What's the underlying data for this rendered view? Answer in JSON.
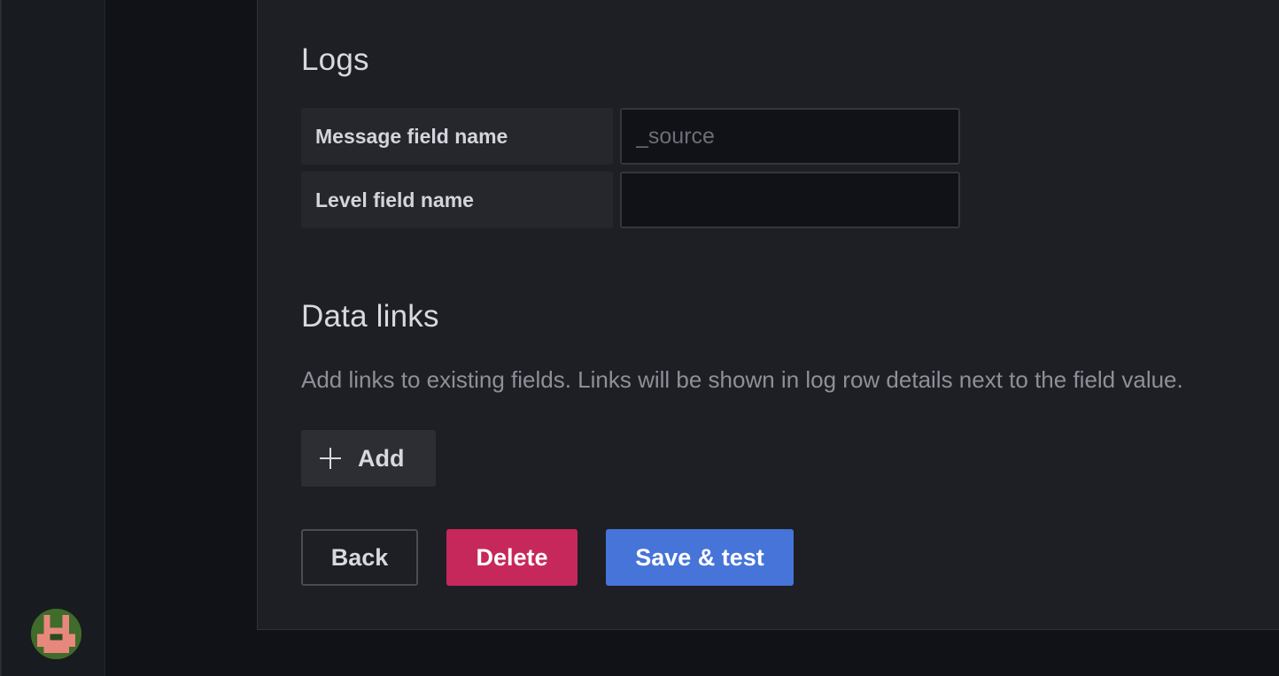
{
  "logs": {
    "title": "Logs",
    "message_field": {
      "label": "Message field name",
      "value": "",
      "placeholder": "_source"
    },
    "level_field": {
      "label": "Level field name",
      "value": "",
      "placeholder": ""
    }
  },
  "data_links": {
    "title": "Data links",
    "description": "Add links to existing fields. Links will be shown in log row details next to the field value.",
    "add_label": "Add",
    "add_icon": "plus-icon"
  },
  "actions": {
    "back_label": "Back",
    "delete_label": "Delete",
    "save_label": "Save & test"
  },
  "colors": {
    "delete": "#c6285b",
    "save": "#4674d8",
    "panel": "#1e1f24"
  }
}
